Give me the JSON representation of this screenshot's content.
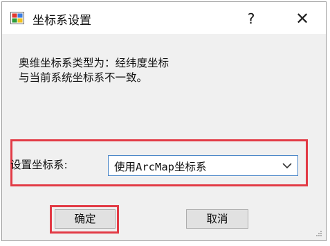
{
  "window": {
    "title": "坐标系设置",
    "help_label": "?",
    "close_label": "✕"
  },
  "message": {
    "line1": "奥维坐标系类型为：经纬度坐标",
    "line2": "与当前系统坐标系不一致。"
  },
  "coordinate": {
    "label": "设置坐标系:",
    "selected": "使用ArcMap坐标系"
  },
  "buttons": {
    "ok": "确定",
    "cancel": "取消"
  },
  "colors": {
    "highlight": "#e23a45",
    "combo_border": "#4a86c8",
    "dialog_bg": "#f0f0f0"
  }
}
